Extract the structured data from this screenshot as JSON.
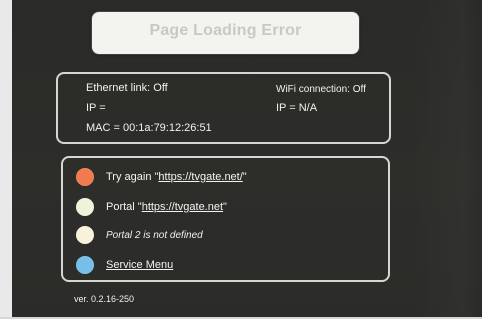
{
  "screen": {
    "title": "Page Loading Error",
    "network": {
      "ethernet_status": "Ethernet link: Off",
      "ethernet_ip": "IP =",
      "mac": "MAC = 00:1a:79:12:26:51",
      "wifi_status": "WiFi connection: Off",
      "wifi_ip": "IP = N/A"
    },
    "menu": {
      "items": [
        {
          "prefix": "Try again \"",
          "link": "https://tvgate.net/",
          "suffix": "\"",
          "icon": "orange-circle-icon",
          "color": "#ef7b4e"
        },
        {
          "prefix": "Portal \"",
          "link": "https://tvgate.net",
          "suffix": "\"",
          "icon": "cream-circle-icon",
          "color": "#f0f3db"
        },
        {
          "text": "Portal 2 is not defined",
          "icon": "cream-circle-icon",
          "color": "#f7f2d9"
        },
        {
          "text": "Service Menu",
          "icon": "blue-circle-icon",
          "color": "#76bfe8"
        }
      ]
    },
    "version": "ver. 0.2.16-250"
  }
}
